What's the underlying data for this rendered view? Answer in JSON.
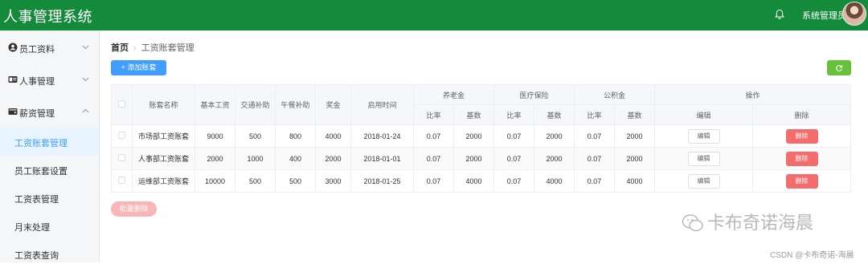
{
  "header": {
    "title": "人事管理系统",
    "user_name": "系统管理员"
  },
  "sidebar": {
    "menus": [
      {
        "label": "员工资料",
        "icon": "user-circle-icon"
      },
      {
        "label": "人事管理",
        "icon": "id-card-icon"
      },
      {
        "label": "薪资管理",
        "icon": "wallet-icon"
      }
    ],
    "sub_items": [
      "工资账套管理",
      "员工账套设置",
      "工资表管理",
      "月末处理",
      "工资表查询"
    ]
  },
  "breadcrumb": {
    "home": "首页",
    "current": "工资账套管理"
  },
  "toolbar": {
    "add_label": "添加账套"
  },
  "table": {
    "headers": {
      "name": "账套名称",
      "base_salary": "基本工资",
      "traffic": "交通补助",
      "lunch": "午餐补助",
      "bonus": "奖金",
      "start_time": "启用时间",
      "pension": "养老金",
      "medical": "医疗保险",
      "fund": "公积金",
      "ratio": "比率",
      "base": "基数",
      "operation": "操作",
      "edit": "编辑",
      "delete": "删除"
    },
    "rows": [
      {
        "name": "市场部工资账套",
        "base_salary": "9000",
        "traffic": "500",
        "lunch": "800",
        "bonus": "4000",
        "start_time": "2018-01-24",
        "pension_ratio": "0.07",
        "pension_base": "2000",
        "medical_ratio": "0.07",
        "medical_base": "2000",
        "fund_ratio": "0.07",
        "fund_base": "2000"
      },
      {
        "name": "人事部工资账套",
        "base_salary": "2000",
        "traffic": "1000",
        "lunch": "400",
        "bonus": "2000",
        "start_time": "2018-01-01",
        "pension_ratio": "0.07",
        "pension_base": "2000",
        "medical_ratio": "0.07",
        "medical_base": "2000",
        "fund_ratio": "0.07",
        "fund_base": "2000"
      },
      {
        "name": "运维部工资账套",
        "base_salary": "10000",
        "traffic": "500",
        "lunch": "500",
        "bonus": "3000",
        "start_time": "2018-01-25",
        "pension_ratio": "0.07",
        "pension_base": "4000",
        "medical_ratio": "0.07",
        "medical_base": "4000",
        "fund_ratio": "0.07",
        "fund_base": "4000"
      }
    ],
    "edit_label": "编辑",
    "delete_label": "删除"
  },
  "batch_delete_label": "批量删除",
  "watermark": {
    "text": "卡布奇诺海晨",
    "csdn": "CSDN @卡布奇诺-海晨"
  },
  "colors": {
    "topbar": "#148b3b",
    "primary": "#409eff",
    "success": "#67c23a",
    "danger": "#f56c6c"
  }
}
